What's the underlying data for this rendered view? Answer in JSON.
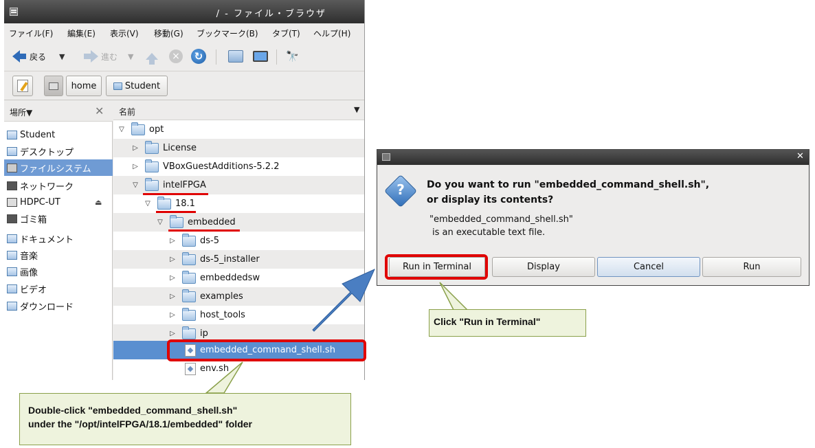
{
  "file_browser": {
    "title": "/ - ファイル・ブラウザ",
    "menu": [
      "ファイル(F)",
      "編集(E)",
      "表示(V)",
      "移動(G)",
      "ブックマーク(B)",
      "タブ(T)",
      "ヘルプ(H)"
    ],
    "toolbar": {
      "back_label": "戻る",
      "forward_label": "進む"
    },
    "path": [
      "home",
      "Student"
    ],
    "sidebar": {
      "header": "場所",
      "items": [
        {
          "label": "Student",
          "icon": "home-folder-icon"
        },
        {
          "label": "デスクトップ",
          "icon": "desktop-folder-icon"
        },
        {
          "label": "ファイルシステム",
          "icon": "drive-icon",
          "selected": true
        },
        {
          "label": "ネットワーク",
          "icon": "network-icon"
        },
        {
          "label": "HDPC-UT",
          "icon": "disk-icon",
          "eject": true
        },
        {
          "label": "ゴミ箱",
          "icon": "trash-icon"
        },
        {
          "label": "ドキュメント",
          "icon": "documents-folder-icon"
        },
        {
          "label": "音楽",
          "icon": "music-folder-icon"
        },
        {
          "label": "画像",
          "icon": "pictures-folder-icon"
        },
        {
          "label": "ビデオ",
          "icon": "videos-folder-icon"
        },
        {
          "label": "ダウンロード",
          "icon": "downloads-folder-icon"
        }
      ]
    },
    "list": {
      "header": "名前",
      "rows": [
        {
          "name": "opt",
          "expanded": true,
          "type": "folder"
        },
        {
          "name": "License",
          "expanded": false,
          "type": "folder"
        },
        {
          "name": "VBoxGuestAdditions-5.2.2",
          "expanded": false,
          "type": "folder"
        },
        {
          "name": "intelFPGA",
          "expanded": true,
          "type": "folder"
        },
        {
          "name": "18.1",
          "expanded": true,
          "type": "folder"
        },
        {
          "name": "embedded",
          "expanded": true,
          "type": "folder"
        },
        {
          "name": "ds-5",
          "expanded": false,
          "type": "folder"
        },
        {
          "name": "ds-5_installer",
          "expanded": false,
          "type": "folder"
        },
        {
          "name": "embeddedsw",
          "expanded": false,
          "type": "folder"
        },
        {
          "name": "examples",
          "expanded": false,
          "type": "folder"
        },
        {
          "name": "host_tools",
          "expanded": false,
          "type": "folder"
        },
        {
          "name": "ip",
          "expanded": false,
          "type": "folder"
        },
        {
          "name": "embedded_command_shell.sh",
          "type": "script",
          "selected": true
        },
        {
          "name": "env.sh",
          "type": "script"
        }
      ]
    }
  },
  "dialog": {
    "question_line1": "Do you want to run \"embedded_command_shell.sh\",",
    "question_line2": "or display its contents?",
    "info_line1": "\"embedded_command_shell.sh\"",
    "info_line2": "is an executable text file.",
    "buttons": {
      "run_in_terminal": "Run in Terminal",
      "display": "Display",
      "cancel": "Cancel",
      "run": "Run"
    }
  },
  "annotations": {
    "callout1_line1": "Double-click \"embedded_command_shell.sh\"",
    "callout1_line2": "under the \"/opt/intelFPGA/18.1/embedded\" folder",
    "callout2": "Click \"Run in Terminal\""
  },
  "colors": {
    "highlight_red": "#e00000",
    "arrow_blue": "#4a7ec2",
    "callout_border": "#8aa04a",
    "selection_blue": "#5a8fd0"
  }
}
